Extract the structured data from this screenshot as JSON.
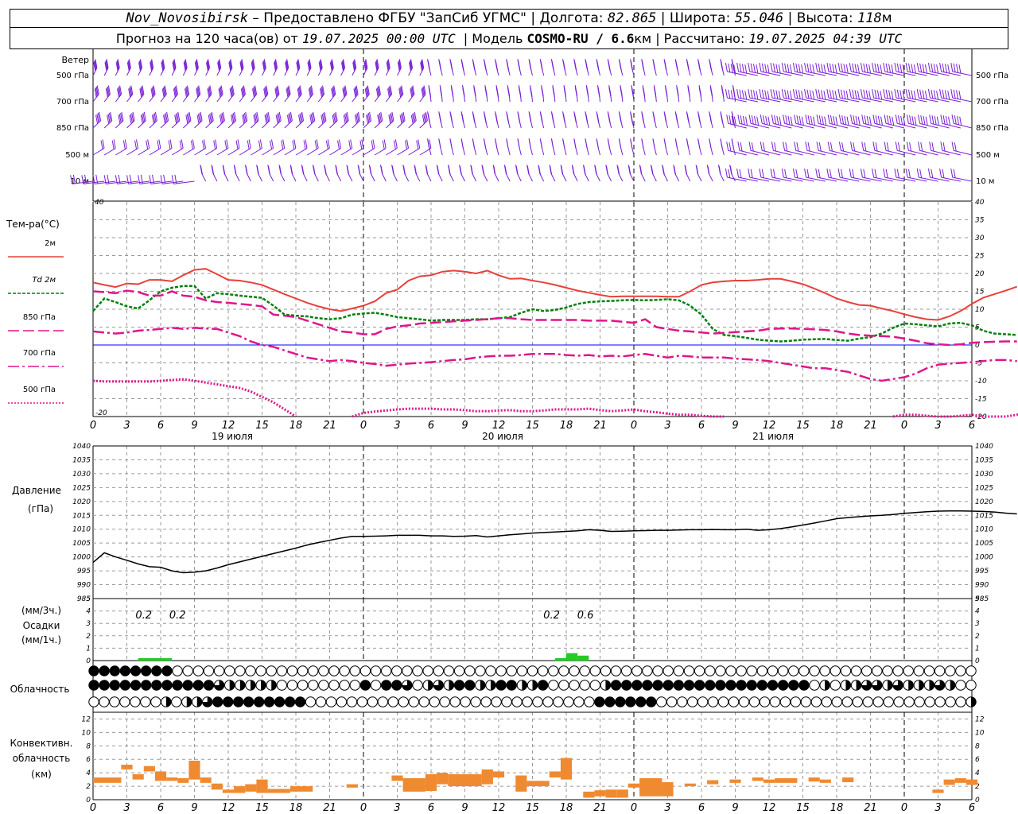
{
  "header": {
    "station": "Nov_Novosibirsk",
    "provider": "– Предоставлено ФГБУ \"ЗапСиб УГМС\" |",
    "lon_label": "Долгота:",
    "lon": "82.865",
    "lat_label": "| Широта:",
    "lat": "55.046",
    "alt_label": "| Высота:",
    "alt": "118",
    "alt_unit": "м",
    "forecast_label": "Прогноз на 120 часа(ов) от",
    "forecast_time": "19.07.2025 00:00 UTC",
    "model_label": "| Модель",
    "model": "COSMO-RU / 6.6",
    "model_unit": "км",
    "calc_label": "| Рассчитано:",
    "calc_time": "19.07.2025 04:39 UTC"
  },
  "labels": {
    "wind": "Ветер",
    "wind_levels": [
      "500 гПа",
      "700 гПа",
      "850 гПа",
      "500 м",
      "10  м"
    ],
    "temp_title": "Тем-ра(°С)",
    "temp_series": [
      "2м",
      "Td  2м",
      "850 гПа",
      "700 гПа",
      "500 гПа"
    ],
    "pressure_title": "Давление",
    "pressure_unit": "(гПа)",
    "precip_lines": [
      "(мм/3ч.)",
      "Осадки",
      "(мм/1ч.)"
    ],
    "cloud_title": "Облачность",
    "conv_lines": [
      "Конвективн.",
      "облачность",
      "(км)"
    ]
  },
  "colors": {
    "wind": "#7a1fd6",
    "t2m": "#e8403a",
    "td2m": "#00800a",
    "t850": "#e0158c",
    "t700": "#e0158c",
    "t500": "#e0158c",
    "zero_line": "#0000ff",
    "pressure": "#000000",
    "precip": "#22cc22",
    "conv": "#f08a30",
    "grid": "#9a9a9a"
  },
  "chart_data": [
    {
      "type": "line",
      "name": "temperature",
      "x_hours": [
        0,
        1,
        2,
        3,
        4,
        5,
        6,
        7,
        8,
        9,
        10,
        11,
        12,
        13,
        14,
        15,
        16,
        17,
        18,
        19,
        20,
        21,
        22,
        23,
        24,
        25,
        26,
        27,
        28,
        29,
        30,
        31,
        32,
        33,
        34,
        35,
        36,
        37,
        38,
        39,
        40,
        41,
        42,
        43,
        44,
        45,
        46,
        47,
        48,
        49,
        50,
        51,
        52,
        53,
        54,
        55,
        56,
        57,
        58,
        59,
        60,
        61,
        62,
        63,
        64,
        65,
        66,
        67,
        68,
        69,
        70,
        71,
        72,
        73,
        74,
        75,
        76,
        77,
        78
      ],
      "x_ticks": [
        "0",
        "3",
        "6",
        "9",
        "12",
        "15",
        "18",
        "21",
        "0",
        "3",
        "6",
        "9",
        "12",
        "15",
        "18",
        "21",
        "0",
        "3",
        "6",
        "9",
        "12",
        "15",
        "18",
        "21",
        "0",
        "3",
        "6"
      ],
      "date_labels": [
        "19 июля",
        "20 июля",
        "21 июля"
      ],
      "ylim": [
        -20,
        40
      ],
      "yticks": [
        -20,
        -15,
        -10,
        -5,
        0,
        5,
        10,
        15,
        20,
        25,
        30,
        35,
        40
      ],
      "series": [
        {
          "key": "t2m",
          "values": [
            17.5,
            16.8,
            16.2,
            17.2,
            17.0,
            18.2,
            18.2,
            17.8,
            19.5,
            21.0,
            21.3,
            19.8,
            18.2,
            18.0,
            17.5,
            16.8,
            15.5,
            14.2,
            13.0,
            11.8,
            10.8,
            10.0,
            9.5,
            10.2,
            11.0,
            12.2,
            14.5,
            15.5,
            18.0,
            19.2,
            19.5,
            20.5,
            20.8,
            20.5,
            20.0,
            20.8,
            19.5,
            18.5,
            18.6,
            18.0,
            17.5,
            16.8,
            16.0,
            15.2,
            14.6,
            14.0,
            13.5,
            13.6,
            13.6,
            13.6,
            13.6,
            13.5,
            13.5,
            15.0,
            16.8,
            17.5,
            17.8,
            18.0,
            18.0,
            18.2,
            18.5,
            18.5,
            17.8,
            17.0,
            15.8,
            14.5,
            13.0,
            12.0,
            11.2,
            11.0,
            10.2,
            9.5,
            8.6,
            7.8,
            7.2,
            7.0,
            8.0,
            9.5,
            11.5,
            13.2,
            14.2,
            15.2,
            16.3
          ]
        },
        {
          "key": "td2m",
          "values": [
            9.5,
            13.0,
            12.0,
            10.8,
            10.2,
            12.5,
            15.0,
            16.0,
            16.5,
            16.5,
            13.0,
            14.5,
            14.2,
            13.8,
            13.5,
            13.2,
            11.0,
            8.5,
            8.2,
            8.0,
            7.5,
            7.2,
            7.5,
            8.5,
            8.8,
            9.0,
            8.5,
            7.8,
            7.5,
            7.2,
            6.8,
            7.0,
            7.0,
            7.0,
            7.2,
            7.2,
            7.5,
            7.8,
            9.0,
            10.0,
            9.5,
            9.8,
            10.5,
            11.5,
            12.0,
            12.2,
            12.3,
            12.5,
            12.6,
            12.5,
            12.6,
            12.8,
            12.5,
            11.0,
            8.5,
            4.5,
            2.8,
            2.5,
            2.0,
            1.5,
            1.2,
            1.0,
            1.2,
            1.5,
            1.6,
            1.7,
            1.4,
            1.2,
            1.8,
            2.2,
            3.2,
            4.8,
            6.0,
            5.8,
            5.5,
            5.2,
            6.0,
            6.2,
            5.5,
            4.0,
            3.2,
            3.0,
            2.8
          ]
        },
        {
          "key": "t850",
          "values": [
            15.0,
            14.8,
            14.5,
            15.2,
            14.8,
            13.8,
            13.8,
            15.0,
            13.8,
            13.5,
            12.5,
            12.0,
            11.8,
            11.5,
            11.2,
            10.8,
            8.5,
            8.2,
            7.8,
            6.8,
            5.8,
            4.8,
            3.8,
            3.5,
            3.0,
            3.0,
            4.5,
            5.2,
            5.5,
            6.0,
            6.2,
            6.4,
            6.6,
            6.8,
            7.0,
            7.2,
            7.5,
            7.5,
            7.2,
            7.0,
            7.0,
            7.0,
            7.0,
            7.0,
            6.8,
            6.8,
            6.8,
            6.5,
            6.2,
            7.2,
            5.0,
            4.5,
            4.0,
            3.8,
            3.5,
            3.2,
            3.4,
            3.6,
            3.8,
            4.0,
            4.5,
            4.6,
            4.6,
            4.5,
            4.4,
            4.2,
            3.8,
            3.2,
            2.8,
            2.6,
            2.5,
            2.3,
            1.8,
            1.2,
            0.5,
            0.2,
            0.0,
            0.2,
            0.6,
            0.8,
            0.9,
            1.0,
            1.0
          ]
        },
        {
          "key": "t700",
          "values": [
            3.8,
            3.5,
            3.2,
            3.5,
            4.0,
            4.2,
            4.5,
            4.8,
            4.5,
            4.8,
            4.6,
            4.5,
            3.5,
            2.5,
            1.0,
            0.0,
            -0.5,
            -1.5,
            -2.5,
            -3.5,
            -4.0,
            -4.5,
            -4.2,
            -4.5,
            -5.0,
            -5.3,
            -5.8,
            -5.5,
            -5.2,
            -5.0,
            -4.8,
            -4.5,
            -4.2,
            -4.0,
            -3.5,
            -3.2,
            -3.0,
            -3.0,
            -2.8,
            -2.5,
            -2.5,
            -2.5,
            -2.8,
            -3.0,
            -2.8,
            -3.2,
            -3.0,
            -3.2,
            -2.8,
            -2.5,
            -3.0,
            -3.5,
            -3.0,
            -3.2,
            -3.5,
            -3.5,
            -3.5,
            -3.8,
            -4.0,
            -4.2,
            -4.5,
            -5.0,
            -5.5,
            -6.0,
            -6.5,
            -6.5,
            -7.0,
            -7.5,
            -8.5,
            -9.5,
            -10.0,
            -9.5,
            -9.0,
            -8.0,
            -6.5,
            -5.5,
            -5.2,
            -5.0,
            -4.8,
            -4.5,
            -4.2,
            -4.2,
            -4.5
          ]
        },
        {
          "key": "t500",
          "values": [
            -10.0,
            -10.2,
            -10.2,
            -10.2,
            -10.2,
            -10.2,
            -10.0,
            -9.8,
            -9.6,
            -10.0,
            -10.5,
            -11.0,
            -11.5,
            -12.0,
            -13.0,
            -14.5,
            -16.0,
            -18.0,
            -20.0,
            null,
            null,
            null,
            null,
            -20.0,
            -19.0,
            -18.6,
            -18.3,
            -18.0,
            -17.8,
            -17.8,
            -17.8,
            -18.0,
            -18.0,
            -18.2,
            -18.5,
            -18.5,
            -18.3,
            -18.2,
            -18.5,
            -18.5,
            -18.3,
            -18.0,
            -18.0,
            -18.0,
            -17.8,
            -18.2,
            -18.5,
            -18.3,
            -18.0,
            -18.5,
            -18.8,
            -19.2,
            -19.5,
            -19.5,
            -19.8,
            -20.0,
            -20.0,
            null,
            null,
            null,
            null,
            null,
            null,
            null,
            null,
            null,
            null,
            null,
            null,
            null,
            null,
            -20.0,
            -19.5,
            -19.5,
            -19.8,
            -20.0,
            -20.0,
            -19.8,
            -19.5,
            -20.0,
            -20.0,
            -20.0,
            -19.5,
            -19.2,
            -19.0
          ]
        }
      ]
    },
    {
      "type": "line",
      "name": "pressure",
      "ylim": [
        985,
        1040
      ],
      "yticks": [
        985,
        990,
        995,
        1000,
        1005,
        1010,
        1015,
        1020,
        1025,
        1030,
        1035,
        1040
      ],
      "values": [
        998.0,
        1001.5,
        1000.0,
        998.8,
        997.5,
        996.5,
        996.3,
        995.0,
        994.3,
        994.5,
        995.0,
        996.0,
        997.2,
        998.2,
        999.2,
        1000.2,
        1001.2,
        1002.2,
        1003.2,
        1004.3,
        1005.2,
        1006.0,
        1006.8,
        1007.4,
        1007.4,
        1007.5,
        1007.6,
        1007.8,
        1007.8,
        1007.8,
        1007.6,
        1007.6,
        1007.4,
        1007.5,
        1007.7,
        1007.2,
        1007.6,
        1008.0,
        1008.3,
        1008.6,
        1008.8,
        1009.0,
        1009.2,
        1009.4,
        1009.8,
        1009.6,
        1009.2,
        1009.3,
        1009.4,
        1009.5,
        1009.6,
        1009.6,
        1009.7,
        1009.8,
        1009.8,
        1009.9,
        1009.8,
        1009.8,
        1010.0,
        1009.6,
        1009.8,
        1010.2,
        1010.8,
        1011.5,
        1012.2,
        1013.0,
        1013.8,
        1014.2,
        1014.5,
        1014.8,
        1015.0,
        1015.3,
        1015.7,
        1016.0,
        1016.3,
        1016.5,
        1016.6,
        1016.6,
        1016.5,
        1016.4,
        1016.2,
        1015.8,
        1015.5
      ]
    },
    {
      "type": "bar",
      "name": "precipitation",
      "ylim": [
        0,
        5
      ],
      "yticks": [
        0,
        1,
        2,
        3,
        4,
        5
      ],
      "bars": [
        {
          "from_h": 4,
          "to_h": 6,
          "value": 0.2
        },
        {
          "from_h": 6,
          "to_h": 7,
          "value": 0.2
        },
        {
          "from_h": 41,
          "to_h": 42,
          "value": 0.2
        },
        {
          "from_h": 42,
          "to_h": 43,
          "value": 0.6
        },
        {
          "from_h": 43,
          "to_h": 44,
          "value": 0.4
        }
      ],
      "annotations": [
        {
          "h": 4.5,
          "text": "0.2"
        },
        {
          "h": 7.5,
          "text": "0.2"
        },
        {
          "h": 40.7,
          "text": "0.2"
        },
        {
          "h": 43.7,
          "text": "0.6"
        }
      ]
    },
    {
      "type": "table",
      "name": "cloudiness",
      "rows": [
        "FFFFFFFF00000000000000000000000000000000000000000000000000000000000000000000000000000",
        "FFFFFFFFFFFF3HHHHH00000000F0FF30H3HFFHHFFHHF00000HFFFFFFFFFFFFFFFFFFF0H0HH33H3HHH3H00",
        "0000000H0HH3FFFFFFFFF0000000000000000000000000000FFFFFF000000000000000000000000000000H"
      ]
    },
    {
      "type": "bar",
      "name": "convective_cloud",
      "ylim": [
        0,
        13
      ],
      "yticks": [
        0,
        2,
        4,
        6,
        8,
        10,
        12
      ],
      "segments": [
        {
          "h0": 0,
          "h1": 2.5,
          "lo": 2.5,
          "hi": 3.3
        },
        {
          "h0": 2.5,
          "h1": 3.5,
          "lo": 4.5,
          "hi": 5.2
        },
        {
          "h0": 3.5,
          "h1": 4.5,
          "lo": 3.0,
          "hi": 3.8
        },
        {
          "h0": 4.5,
          "h1": 5.5,
          "lo": 4.2,
          "hi": 5.0
        },
        {
          "h0": 5.5,
          "h1": 6.5,
          "lo": 2.8,
          "hi": 4.2
        },
        {
          "h0": 6.5,
          "h1": 7.5,
          "lo": 2.8,
          "hi": 3.3
        },
        {
          "h0": 7.5,
          "h1": 8.5,
          "lo": 2.5,
          "hi": 3.2
        },
        {
          "h0": 8.5,
          "h1": 9.5,
          "lo": 3.0,
          "hi": 5.8
        },
        {
          "h0": 9.5,
          "h1": 10.5,
          "lo": 2.5,
          "hi": 3.3
        },
        {
          "h0": 10.5,
          "h1": 11.5,
          "lo": 1.5,
          "hi": 2.4
        },
        {
          "h0": 11.5,
          "h1": 12.5,
          "lo": 1.0,
          "hi": 1.5
        },
        {
          "h0": 12.5,
          "h1": 13.5,
          "lo": 1.0,
          "hi": 2.0
        },
        {
          "h0": 13.5,
          "h1": 14.5,
          "lo": 1.2,
          "hi": 2.3
        },
        {
          "h0": 14.5,
          "h1": 15.5,
          "lo": 1.0,
          "hi": 3.0
        },
        {
          "h0": 15.5,
          "h1": 17.5,
          "lo": 1.0,
          "hi": 1.6
        },
        {
          "h0": 17.5,
          "h1": 19.5,
          "lo": 1.2,
          "hi": 2.0
        },
        {
          "h0": 22.5,
          "h1": 23.5,
          "lo": 1.8,
          "hi": 2.3
        },
        {
          "h0": 26.5,
          "h1": 27.5,
          "lo": 2.8,
          "hi": 3.6
        },
        {
          "h0": 27.5,
          "h1": 29.5,
          "lo": 1.2,
          "hi": 3.2
        },
        {
          "h0": 29.5,
          "h1": 30.5,
          "lo": 1.3,
          "hi": 3.8
        },
        {
          "h0": 30.5,
          "h1": 31.5,
          "lo": 2.3,
          "hi": 4.0
        },
        {
          "h0": 31.5,
          "h1": 34.5,
          "lo": 2.0,
          "hi": 3.8
        },
        {
          "h0": 34.5,
          "h1": 35.5,
          "lo": 2.3,
          "hi": 4.5
        },
        {
          "h0": 35.5,
          "h1": 36.5,
          "lo": 3.3,
          "hi": 4.2
        },
        {
          "h0": 37.5,
          "h1": 38.5,
          "lo": 1.2,
          "hi": 3.6
        },
        {
          "h0": 38.5,
          "h1": 40.5,
          "lo": 2.0,
          "hi": 2.8
        },
        {
          "h0": 40.5,
          "h1": 41.5,
          "lo": 3.3,
          "hi": 4.2
        },
        {
          "h0": 41.5,
          "h1": 42.5,
          "lo": 3.0,
          "hi": 6.2
        },
        {
          "h0": 43.5,
          "h1": 44.5,
          "lo": 0.3,
          "hi": 1.2
        },
        {
          "h0": 44.5,
          "h1": 45.5,
          "lo": 0.5,
          "hi": 1.4
        },
        {
          "h0": 45.5,
          "h1": 46.5,
          "lo": 0.3,
          "hi": 1.5
        },
        {
          "h0": 46.5,
          "h1": 47.5,
          "lo": 0.3,
          "hi": 1.5
        },
        {
          "h0": 47.5,
          "h1": 48.5,
          "lo": 1.8,
          "hi": 2.4
        },
        {
          "h0": 48.5,
          "h1": 50.5,
          "lo": 0.5,
          "hi": 3.2
        },
        {
          "h0": 50.5,
          "h1": 51.5,
          "lo": 0.5,
          "hi": 2.6
        },
        {
          "h0": 52.5,
          "h1": 53.5,
          "lo": 2.0,
          "hi": 2.4
        },
        {
          "h0": 54.5,
          "h1": 55.5,
          "lo": 2.3,
          "hi": 2.9
        },
        {
          "h0": 56.5,
          "h1": 57.5,
          "lo": 2.5,
          "hi": 3.0
        },
        {
          "h0": 58.5,
          "h1": 59.5,
          "lo": 2.8,
          "hi": 3.3
        },
        {
          "h0": 59.5,
          "h1": 60.5,
          "lo": 2.5,
          "hi": 3.0
        },
        {
          "h0": 60.5,
          "h1": 62.5,
          "lo": 2.5,
          "hi": 3.2
        },
        {
          "h0": 63.5,
          "h1": 64.5,
          "lo": 2.7,
          "hi": 3.3
        },
        {
          "h0": 64.5,
          "h1": 65.5,
          "lo": 2.5,
          "hi": 3.0
        },
        {
          "h0": 66.5,
          "h1": 67.5,
          "lo": 2.6,
          "hi": 3.3
        },
        {
          "h0": 74.5,
          "h1": 75.5,
          "lo": 1.0,
          "hi": 1.5
        },
        {
          "h0": 75.5,
          "h1": 76.5,
          "lo": 2.2,
          "hi": 3.0
        },
        {
          "h0": 76.5,
          "h1": 77.5,
          "lo": 2.5,
          "hi": 3.2
        },
        {
          "h0": 77.5,
          "h1": 78.5,
          "lo": 2.2,
          "hi": 3.0
        }
      ]
    }
  ]
}
